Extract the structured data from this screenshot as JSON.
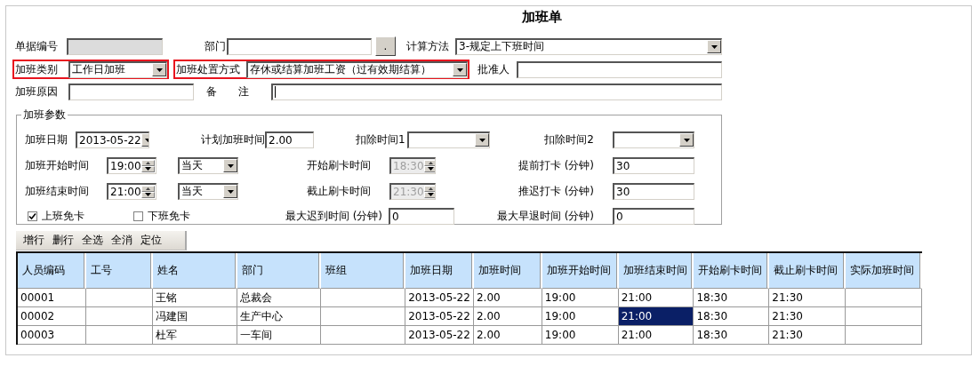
{
  "title": "加班单",
  "form": {
    "fields": [
      {
        "label": "单据编号",
        "kind": "input",
        "disabled": true
      },
      {
        "label": "部门",
        "kind": "input",
        "disabled": false,
        "button": "."
      },
      {
        "label": "计算方法",
        "kind": "select",
        "value": "3-规定上下班时间"
      },
      {
        "label": "加班类别",
        "kind": "select",
        "value": "工作日加班",
        "highlighted": true
      },
      {
        "label": "加班处置方式",
        "kind": "select",
        "value": "存休或结算加班工资（过有效期结算）",
        "highlighted": true
      },
      {
        "label": "批准人",
        "kind": "input",
        "disabled": false
      },
      {
        "label": "加班原因",
        "kind": "input",
        "disabled": false
      },
      {
        "label": "备　　注",
        "kind": "input",
        "disabled": false,
        "focused": true
      }
    ]
  },
  "params": {
    "legend": "加班参数",
    "fields": [
      {
        "label": "加班日期",
        "kind": "select",
        "value": "2013-05-22"
      },
      {
        "label": "计划加班时间",
        "kind": "input",
        "value": "2.00",
        "disabled": false
      },
      {
        "label": "扣除时间1",
        "kind": "select"
      },
      {
        "label": "扣除时间2",
        "kind": "select"
      },
      {
        "label": "加班开始时间",
        "kind": "spinner",
        "value": "19:00",
        "disabled": false,
        "day": "当天"
      },
      {
        "label": "开始刷卡时间",
        "kind": "spinner",
        "value": "18:30",
        "disabled": true
      },
      {
        "label": "提前打卡 (分钟)",
        "kind": "input",
        "value": "30",
        "disabled": false
      },
      {
        "label": "加班结束时间",
        "kind": "spinner",
        "value": "21:00",
        "disabled": false,
        "day": "当天"
      },
      {
        "label": "截止刷卡时间",
        "kind": "spinner",
        "value": "21:30",
        "disabled": true
      },
      {
        "label": "推迟打卡 (分钟)",
        "kind": "input",
        "value": "30",
        "disabled": false
      },
      {
        "label": "上班免卡",
        "kind": "checkbox",
        "checked": true
      },
      {
        "label": "下班免卡",
        "kind": "checkbox",
        "checked": false
      },
      {
        "label": "最大迟到时间 (分钟)",
        "kind": "input",
        "value": "0",
        "disabled": false
      },
      {
        "label": "最大早退时间 (分钟)",
        "kind": "input",
        "value": "0",
        "disabled": false
      }
    ]
  },
  "toolbar": [
    "增行",
    "删行",
    "全选",
    "全消",
    "定位"
  ],
  "table": {
    "columns": [
      "人员编码",
      "工号",
      "姓名",
      "部门",
      "班组",
      "加班日期",
      "加班时间",
      "加班开始时间",
      "加班结束时间",
      "开始刷卡时间",
      "截止刷卡时间",
      "实际加班时间"
    ],
    "rows": [
      {
        "cells": [
          {
            "text": "00001",
            "selected": false
          },
          {
            "selected": false
          },
          {
            "text": "王铭",
            "selected": false
          },
          {
            "text": "总裁会",
            "selected": false
          },
          {
            "selected": false
          },
          {
            "text": "2013-05-22",
            "selected": false
          },
          {
            "text": "2.00",
            "selected": false
          },
          {
            "text": "19:00",
            "selected": false
          },
          {
            "text": "21:00",
            "selected": false
          },
          {
            "text": "18:30",
            "selected": false
          },
          {
            "text": "21:30",
            "selected": false
          },
          {
            "selected": false
          }
        ]
      },
      {
        "cells": [
          {
            "text": "00002",
            "selected": false
          },
          {
            "selected": false
          },
          {
            "text": "冯建国",
            "selected": false
          },
          {
            "text": "生产中心",
            "selected": false
          },
          {
            "selected": false
          },
          {
            "text": "2013-05-22",
            "selected": false
          },
          {
            "text": "2.00",
            "selected": false
          },
          {
            "text": "19:00",
            "selected": false
          },
          {
            "text": "21:00",
            "selected": true
          },
          {
            "text": "18:30",
            "selected": false
          },
          {
            "text": "21:30",
            "selected": false
          },
          {
            "selected": false
          }
        ]
      },
      {
        "cells": [
          {
            "text": "00003",
            "selected": false
          },
          {
            "selected": false
          },
          {
            "text": "杜军",
            "selected": false
          },
          {
            "text": "一车间",
            "selected": false
          },
          {
            "selected": false
          },
          {
            "text": "2013-05-22",
            "selected": false
          },
          {
            "text": "2.00",
            "selected": false
          },
          {
            "text": "19:00",
            "selected": false
          },
          {
            "text": "21:00",
            "selected": false
          },
          {
            "text": "18:30",
            "selected": false
          },
          {
            "text": "21:30",
            "selected": false
          },
          {
            "selected": false
          }
        ]
      }
    ]
  }
}
